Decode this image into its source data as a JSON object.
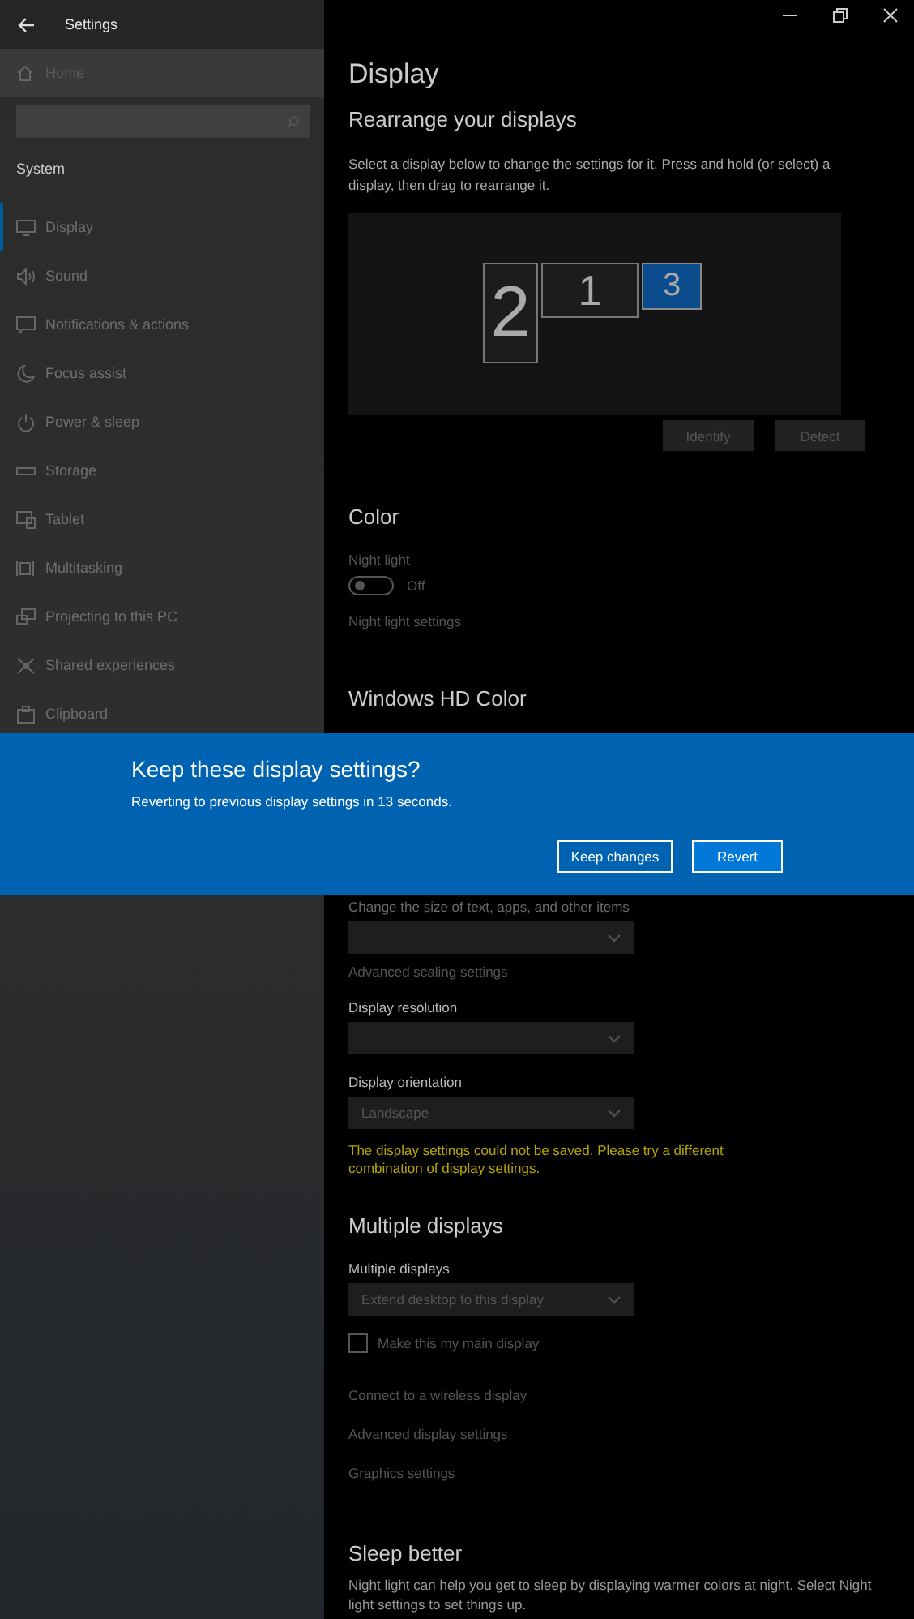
{
  "window": {
    "title": "Settings"
  },
  "sidebar": {
    "home": "Home",
    "section": "System",
    "items": [
      {
        "label": "Display",
        "selected": true
      },
      {
        "label": "Sound",
        "selected": false
      },
      {
        "label": "Notifications & actions",
        "selected": false
      },
      {
        "label": "Focus assist",
        "selected": false
      },
      {
        "label": "Power & sleep",
        "selected": false
      },
      {
        "label": "Storage",
        "selected": false
      },
      {
        "label": "Tablet",
        "selected": false
      },
      {
        "label": "Multitasking",
        "selected": false
      },
      {
        "label": "Projecting to this PC",
        "selected": false
      },
      {
        "label": "Shared experiences",
        "selected": false
      },
      {
        "label": "Clipboard",
        "selected": false
      }
    ]
  },
  "page": {
    "title": "Display"
  },
  "arrange": {
    "heading": "Rearrange your displays",
    "description": "Select a display below to change the settings for it. Press and hold (or select) a display, then drag to rearrange it.",
    "monitors": [
      {
        "label": "2",
        "selected": false
      },
      {
        "label": "1",
        "selected": false
      },
      {
        "label": "3",
        "selected": true
      }
    ],
    "buttons": [
      "Identify",
      "Detect"
    ]
  },
  "color": {
    "heading": "Color",
    "night_light": {
      "label": "Night light",
      "on": false,
      "state_text": "Off"
    },
    "link": "Night light settings"
  },
  "hd_color": {
    "heading": "Windows HD Color"
  },
  "dialog": {
    "title": "Keep these display settings?",
    "message": "Reverting to previous display settings in 13 seconds.",
    "buttons": [
      {
        "label": "Keep changes",
        "selected": false
      },
      {
        "label": "Revert",
        "selected": true
      }
    ]
  },
  "scale": {
    "label": "Change the size of text, apps, and other items",
    "link": "Advanced scaling settings"
  },
  "resolution": {
    "label": "Display resolution"
  },
  "orientation": {
    "label": "Display orientation",
    "value": "Landscape"
  },
  "warning": "The display settings could not be saved. Please try a different combination of display settings.",
  "multiple": {
    "heading": "Multiple displays",
    "label": "Multiple displays",
    "value": "Extend desktop to this display",
    "checkbox": {
      "label": "Make this my main display",
      "checked": false
    },
    "links": [
      "Connect to a wireless display",
      "Advanced display settings",
      "Graphics settings"
    ]
  },
  "sleep": {
    "heading": "Sleep better",
    "text": "Night light can help you get to sleep by displaying warmer colors at night. Select Night light settings to set things up."
  }
}
